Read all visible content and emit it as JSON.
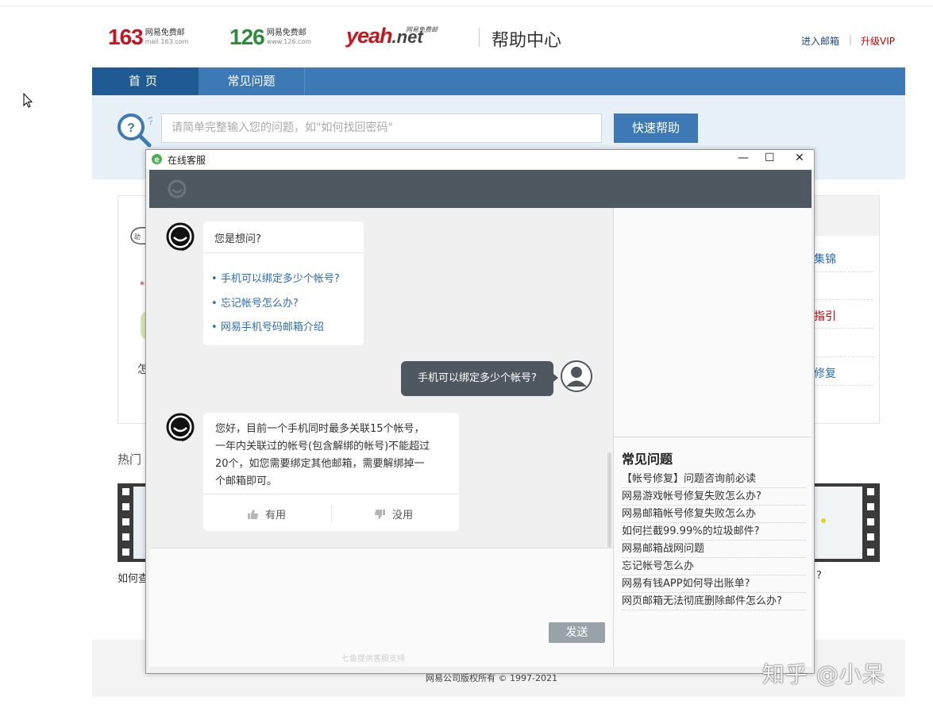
{
  "header": {
    "logo163": {
      "num": "163",
      "title": "网易免费邮",
      "domain": "mail.163.com",
      "color": "#c8141e"
    },
    "logo126": {
      "num": "126",
      "title": "网易免费邮",
      "domain": "www.126.com",
      "color": "#2e8b3a"
    },
    "logoYeah": {
      "text": "yeah",
      "net": ".net",
      "tag": "网易免费邮",
      "color": "#c8141e"
    },
    "help_center": "帮助中心",
    "enter_mail": "进入邮箱",
    "separator": "|",
    "upgrade_vip": "升级VIP"
  },
  "nav": {
    "home": "首页",
    "faq": "常见问题"
  },
  "search": {
    "placeholder": "请简单完整输入您的问题，如\"如何找回密码\"",
    "button": "快速帮助"
  },
  "background": {
    "right_links": [
      "集锦",
      "指引",
      "修复"
    ],
    "hot_label": "热门",
    "left_fragment": "怎",
    "caption_left": "如何查",
    "caption_right": "?",
    "copyright": "网易公司版权所有 © 1997-2021"
  },
  "dialog": {
    "title": "在线客服",
    "controls": {
      "minimize": "—",
      "maximize": "☐",
      "close": "✕"
    },
    "bot_question": "您是想问?",
    "suggestions": [
      "手机可以绑定多少个帐号?",
      "忘记帐号怎么办?",
      "网易手机号码邮箱介绍"
    ],
    "user_message": "手机可以绑定多少个帐号?",
    "bot_answer_lines": [
      "您好，目前一个手机同时最多关联15个帐号，",
      "一年内关联过的帐号(包含解绑的帐号)不能超过",
      "20个，如您需要绑定其他邮箱，需要解绑掉一",
      "个邮箱即可。"
    ],
    "useful": "有用",
    "useless": "没用",
    "send": "发送",
    "powered": "七鱼提供客服支持",
    "faq_title": "常见问题",
    "faq_items": [
      "【帐号修复】问题咨询前必读",
      "网易游戏帐号修复失败怎么办?",
      "网易邮箱帐号修复失败怎么办",
      "如何拦截99.99%的垃圾邮件?",
      "网易邮箱战网问题",
      "忘记帐号怎么办",
      "网易有钱APP如何导出账单?",
      "网页邮箱无法彻底删除邮件怎么办?"
    ]
  },
  "watermark": "知乎 @小呆",
  "colors": {
    "nav": "#3d7ab5",
    "nav_active": "#1f5a93",
    "dialog_header": "#4f5861",
    "link": "#2b6cb0"
  }
}
